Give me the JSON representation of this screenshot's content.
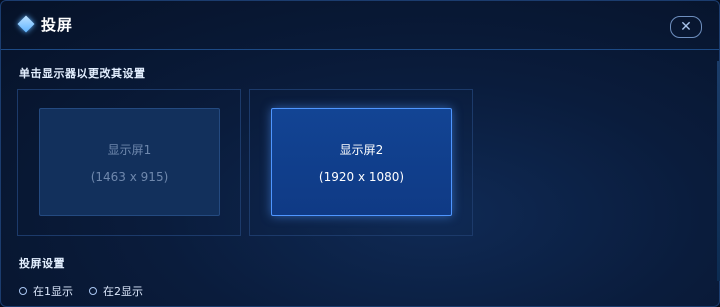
{
  "dialog": {
    "title": "投屏",
    "close_symbol": "✕"
  },
  "hint": "单击显示器以更改其设置",
  "displays": [
    {
      "name": "显示屏1",
      "resolution": "(1463 x 915)",
      "selected": false
    },
    {
      "name": "显示屏2",
      "resolution": "(1920 x 1080)",
      "selected": true
    }
  ],
  "projection_settings": {
    "label": "投屏设置",
    "options": [
      {
        "label": "在1显示",
        "selected": false
      },
      {
        "label": "在2显示",
        "selected": false
      }
    ]
  },
  "colors": {
    "accent": "#4f96ff",
    "background": "#0a1c3c",
    "selected_screen": "#124494",
    "unselected_screen": "#12305c"
  },
  "icons": {
    "title_icon": "diamond-icon",
    "close_icon": "close-icon"
  }
}
